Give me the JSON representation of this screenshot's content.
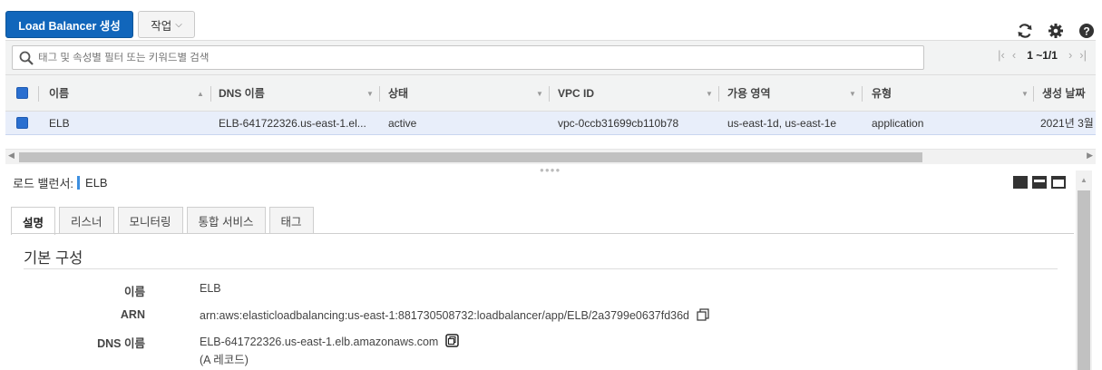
{
  "toolbar": {
    "create_label": "Load Balancer 생성",
    "actions_label": "작업",
    "icons": [
      "refresh-icon",
      "gear-icon",
      "help-icon"
    ]
  },
  "search": {
    "placeholder": "태그 및 속성별 필터 또는 키워드별 검색",
    "pagination": "1 ~1/1"
  },
  "table": {
    "columns": [
      "이름",
      "DNS 이름",
      "상태",
      "VPC ID",
      "가용 영역",
      "유형",
      "생성 날짜"
    ],
    "rows": [
      {
        "name": "ELB",
        "dns": "ELB-641722326.us-east-1.el...",
        "state": "active",
        "vpc": "vpc-0ccb31699cb110b78",
        "az": "us-east-1d, us-east-1e",
        "type": "application",
        "created": "2021년 3월"
      }
    ]
  },
  "details": {
    "title_prefix": "로드 밸런서:",
    "title_name": "ELB",
    "tabs": [
      "설명",
      "리스너",
      "모니터링",
      "통합 서비스",
      "태그"
    ],
    "active_tab": "설명",
    "section_title": "기본 구성",
    "fields": {
      "name_label": "이름",
      "name_value": "ELB",
      "arn_label": "ARN",
      "arn_value": "arn:aws:elasticloadbalancing:us-east-1:881730508732:loadbalancer/app/ELB/2a3799e0637fd36d",
      "dns_label": "DNS 이름",
      "dns_value": "ELB-641722326.us-east-1.elb.amazonaws.com",
      "dns_note": "(A 레코드)"
    }
  },
  "colors": {
    "primary": "#1166bb",
    "selected_row": "#e8eefa",
    "checkbox": "#2a6fd0",
    "accent_bar": "#3d8fe0"
  }
}
